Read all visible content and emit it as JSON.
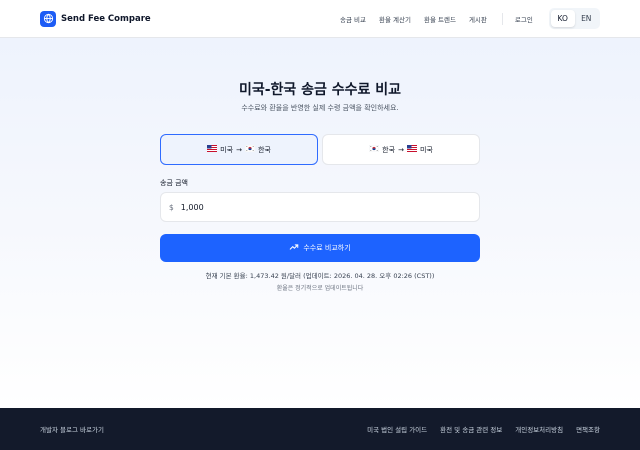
{
  "header": {
    "brand_name": "Send Fee Compare",
    "nav": [
      "송금 비교",
      "환율 계산기",
      "환율 트렌드",
      "게시판"
    ],
    "login": "로그인",
    "lang": {
      "ko": "KO",
      "en": "EN",
      "selected": "KO"
    }
  },
  "main": {
    "title": "미국-한국 송금 수수료 비교",
    "subtitle": "수수료와 환율을 반영한 실제 수령 금액을 확인하세요.",
    "directions": [
      {
        "from": "미국",
        "to": "한국",
        "active": true
      },
      {
        "from": "한국",
        "to": "미국",
        "active": false
      }
    ],
    "amount_label": "송금 금액",
    "currency_symbol": "$",
    "amount_value": "1,000",
    "compare_button": "수수료 비교하기",
    "rate_info": "현재 기본 환율: 1,473.42 원/달러  (업데이트: 2026. 04. 28. 오후 02:26 (CST))",
    "rate_note": "환율은 정기적으로 업데이트됩니다"
  },
  "footer": {
    "blog_link": "개발자 블로그 바로가기",
    "links": [
      "미국 법인 설립 가이드",
      "환전 및 송금 관련 정보",
      "개인정보처리방침",
      "면책조항"
    ]
  },
  "colors": {
    "primary": "#1d63ff",
    "footer_bg": "#131a2b",
    "brand_logo": "#1d5cf5"
  },
  "icons": [
    "globe-icon",
    "us-flag-icon",
    "kr-flag-icon",
    "arrow-right-icon",
    "trending-up-icon"
  ]
}
